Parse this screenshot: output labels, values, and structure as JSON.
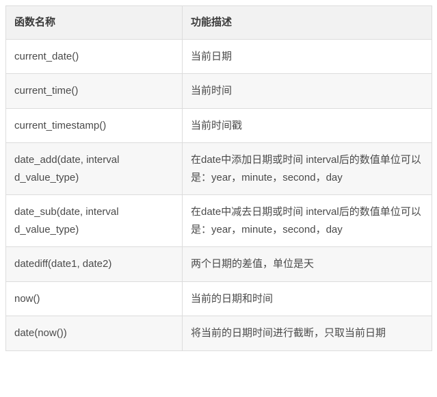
{
  "table": {
    "headers": [
      "函数名称",
      "功能描述"
    ],
    "rows": [
      {
        "fn": "current_date()",
        "desc": "当前日期"
      },
      {
        "fn": "current_time()",
        "desc": "当前时间"
      },
      {
        "fn": "current_timestamp()",
        "desc": "当前时间戳"
      },
      {
        "fn": "date_add(date, interval d_value_type)",
        "desc": "在date中添加日期或时间 interval后的数值单位可以是：year，minute，second，day"
      },
      {
        "fn": "date_sub(date, interval d_value_type)",
        "desc": "在date中减去日期或时间 interval后的数值单位可以是：year，minute，second，day"
      },
      {
        "fn": "datediff(date1, date2)",
        "desc": "两个日期的差值，单位是天"
      },
      {
        "fn": "now()",
        "desc": "当前的日期和时间"
      },
      {
        "fn": "date(now())",
        "desc": "将当前的日期时间进行截断，只取当前日期"
      }
    ]
  }
}
